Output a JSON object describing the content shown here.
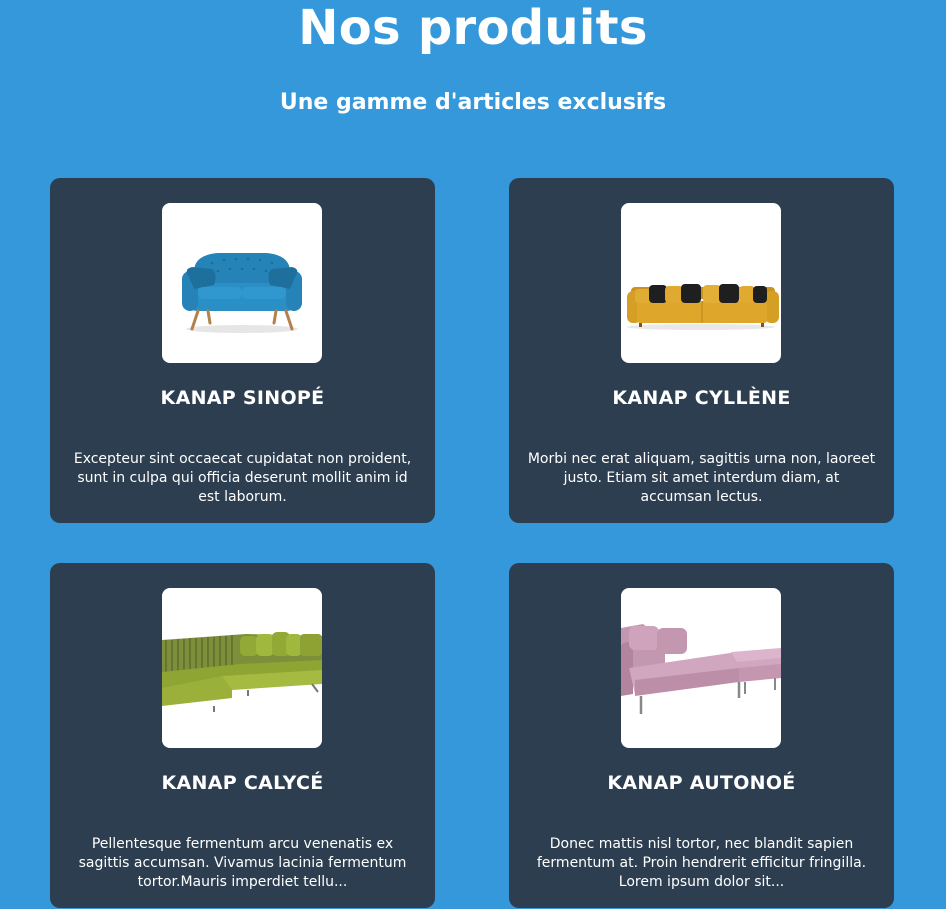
{
  "header": {
    "title": "Nos produits",
    "subtitle": "Une gamme d'articles exclusifs"
  },
  "products": [
    {
      "name": "KANAP SINOPÉ",
      "description": "Excepteur sint occaecat cupidatat non proident, sunt in culpa qui officia deserunt mollit anim id est laborum.",
      "image_icon": "blue-sofa-image",
      "color": "#2a8fc4"
    },
    {
      "name": "KANAP CYLLÈNE",
      "description": "Morbi nec erat aliquam, sagittis urna non, laoreet justo. Etiam sit amet interdum diam, at accumsan lectus.",
      "image_icon": "yellow-sofa-image",
      "color": "#d9a429"
    },
    {
      "name": "KANAP CALYCÉ",
      "description": "Pellentesque fermentum arcu venenatis ex sagittis accumsan. Vivamus lacinia fermentum tortor.Mauris imperdiet tellu...",
      "image_icon": "green-sofa-image",
      "color": "#9ab03a"
    },
    {
      "name": "KANAP AUTONOÉ",
      "description": "Donec mattis nisl tortor, nec blandit sapien fermentum at. Proin hendrerit efficitur fringilla. Lorem ipsum dolor sit...",
      "image_icon": "pink-sofa-image",
      "color": "#c99bb5"
    }
  ],
  "colors": {
    "background": "#3498db",
    "card": "#2c3e50",
    "text": "#ffffff"
  }
}
